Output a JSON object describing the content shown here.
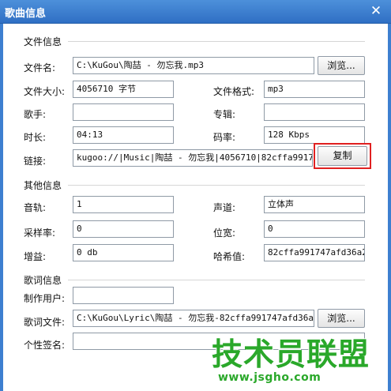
{
  "window": {
    "title": "歌曲信息"
  },
  "file_info": {
    "heading": "文件信息",
    "filename_label": "文件名:",
    "filename_value": "C:\\KuGou\\陶喆 - 勿忘我.mp3",
    "browse_label": "浏览...",
    "size_label": "文件大小:",
    "size_value": "4056710 字节",
    "format_label": "文件格式:",
    "format_value": "mp3",
    "singer_label": "歌手:",
    "singer_value": "",
    "album_label": "专辑:",
    "album_value": "",
    "duration_label": "时长:",
    "duration_value": "04:13",
    "bitrate_label": "码率:",
    "bitrate_value": "128 Kbps",
    "link_label": "链接:",
    "link_value": "kugoo://|Music|陶喆 - 勿忘我|4056710|82cffa991747afd",
    "copy_label": "复制"
  },
  "other_info": {
    "heading": "其他信息",
    "track_label": "音轨:",
    "track_value": "1",
    "channel_label": "声道:",
    "channel_value": "立体声",
    "samplerate_label": "采样率:",
    "samplerate_value": "0",
    "bitdepth_label": "位宽:",
    "bitdepth_value": "0",
    "gain_label": "增益:",
    "gain_value": "0 db",
    "hash_label": "哈希值:",
    "hash_value": "82cffa991747afd36a24"
  },
  "lyric_info": {
    "heading": "歌词信息",
    "creator_label": "制作用户:",
    "creator_value": "",
    "lyricfile_label": "歌词文件:",
    "lyricfile_value": "C:\\KuGou\\Lyric\\陶喆 - 勿忘我-82cffa991747afd36a24",
    "browse_label": "浏览...",
    "signature_label": "个性签名:",
    "signature_value": ""
  },
  "watermark": {
    "main": "技术员联盟",
    "url": "www.jsgho.com"
  },
  "colors": {
    "titlebar": "#3d7fd0",
    "highlight": "#e02020",
    "watermark": "#2aa82a"
  }
}
